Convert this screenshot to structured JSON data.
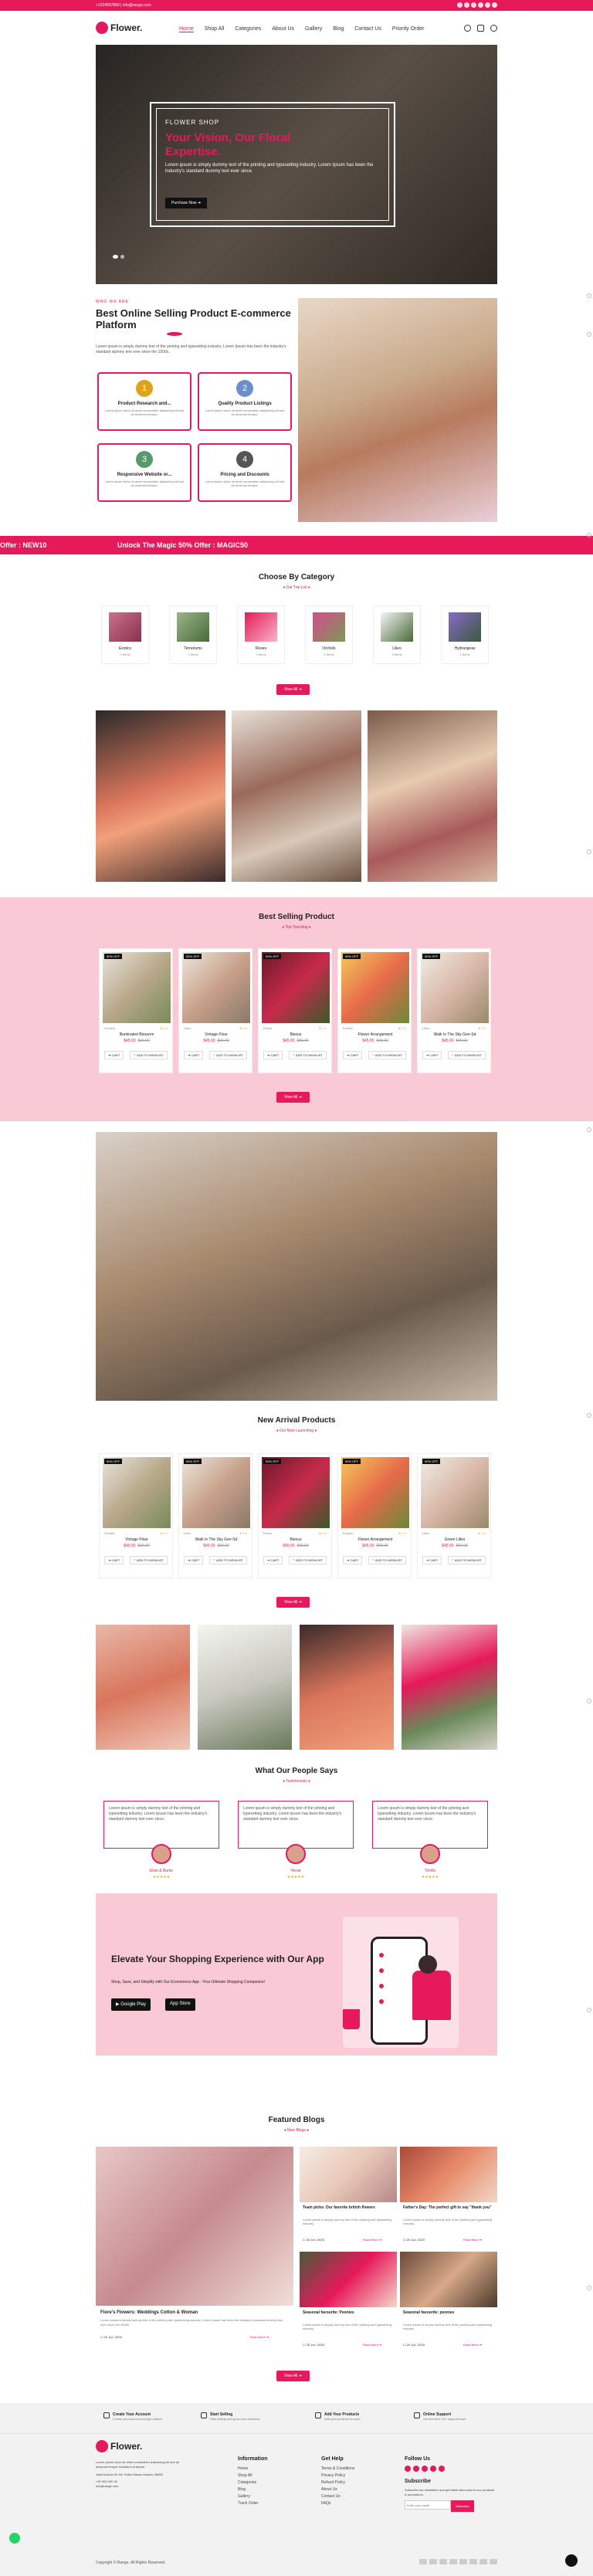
{
  "topbar": {
    "phone": "+1234567890",
    "email": "info@range.com",
    "socials": [
      "facebook-icon",
      "instagram-icon",
      "twitter-icon",
      "youtube-icon",
      "pinterest-icon",
      "linkedin-icon"
    ]
  },
  "header": {
    "logo": "Flower.",
    "nav": [
      "Home",
      "Shop All",
      "Categories",
      "About Us",
      "Gallery",
      "Blog",
      "Contact Us",
      "Priority Order"
    ],
    "active_nav": "Home"
  },
  "hero": {
    "kicker": "FLOWER SHOP",
    "title": "Your Vision, Our Floral Expertise.",
    "desc": "Lorem ipsum is simply dummy text of the printing and typesetting industry. Lorem Ipsum has been the industry's standard dummy text ever since.",
    "button": "Purchase Now  ➜"
  },
  "about": {
    "kicker": "WHO WE ARE",
    "title": "Best Online Selling Product E-commerce Platform",
    "desc": "Lorem ipsum is simply dummy text of the printing and typesetting industry. Lorem Ipsum has been the industry's standard dummy text ever since the 1500s.",
    "features": [
      {
        "num": "1",
        "title": "Product Research and...",
        "desc": "Lorem ipsum dolor sit amet consectetur adipiscing elit sed do eiusmod tempor.",
        "color": "#e0a21a"
      },
      {
        "num": "2",
        "title": "Quality Product Listings",
        "desc": "Lorem ipsum dolor sit amet consectetur adipiscing elit sed do eiusmod tempor.",
        "color": "#6a8fc9"
      },
      {
        "num": "3",
        "title": "Responsive Website or...",
        "desc": "Lorem ipsum dolor sit amet consectetur adipiscing elit sed do eiusmod tempor.",
        "color": "#5a9a6a"
      },
      {
        "num": "4",
        "title": "Pricing and Discounts",
        "desc": "Lorem ipsum dolor sit amet consectetur adipiscing elit sed do eiusmod tempor.",
        "color": "#555555"
      }
    ]
  },
  "marquee": {
    "left": "Offer : NEW10",
    "center": "Unlock The Magic 50% Offer : MAGIC50"
  },
  "categories": {
    "title": "Choose By Category",
    "subtitle": "♦ Our Top List ♦",
    "button": "View All  ➜",
    "items": [
      {
        "name": "Exotics",
        "count": "2 Items"
      },
      {
        "name": "Terrariums",
        "count": "3 Items"
      },
      {
        "name": "Roses",
        "count": "2 Items"
      },
      {
        "name": "Orchids",
        "count": "1 Items"
      },
      {
        "name": "Lilies",
        "count": "3 Items"
      },
      {
        "name": "Hydrangeas",
        "count": "1 Items"
      }
    ]
  },
  "best": {
    "title": "Best Selling Product",
    "subtitle": "♦ Top Trending ♦",
    "button": "View All  ➜",
    "products": [
      {
        "badge": "50% OFF",
        "cat": "Orchids",
        "name": "Illuminated Blossom",
        "price": "$45.00",
        "old": "$90.00",
        "rating": "★ 4.0"
      },
      {
        "badge": "50% OFF",
        "cat": "Lilies",
        "name": "Vintage Flour",
        "price": "$45.00",
        "old": "$90.00",
        "rating": "★ 4.0"
      },
      {
        "badge": "50% OFF",
        "cat": "Roses",
        "name": "Bisous",
        "price": "$45.00",
        "old": "$90.00",
        "rating": "★ 4.0"
      },
      {
        "badge": "50% OFF",
        "cat": "Exotics",
        "name": "Flower Arrangement",
        "price": "$45.00",
        "old": "$90.00",
        "rating": "★ 4.0"
      },
      {
        "badge": "50% OFF",
        "cat": "Lilies",
        "name": "Walk In The Sky Gen-Sd",
        "price": "$45.00",
        "old": "$90.00",
        "rating": "★ 4.0"
      }
    ],
    "cart": "➜ CART",
    "wish": "♡ ADD TO WISHLIST"
  },
  "arrivals": {
    "title": "New Arrival Products",
    "subtitle": "♦ Our New Launching ♦",
    "button": "View All  ➜",
    "products": [
      {
        "badge": "50% OFF",
        "cat": "Orchids",
        "name": "Vintage Flour",
        "price": "$45.00",
        "old": "$90.00",
        "rating": "★ 4.0"
      },
      {
        "badge": "50% OFF",
        "cat": "Lilies",
        "name": "Walk In The Sky Gen-Sd",
        "price": "$45.00",
        "old": "$90.00",
        "rating": "★ 4.0"
      },
      {
        "badge": "50% OFF",
        "cat": "Roses",
        "name": "Bisous",
        "price": "$45.00",
        "old": "$90.00",
        "rating": "★ 4.0"
      },
      {
        "badge": "50% OFF",
        "cat": "Exotics",
        "name": "Flower Arrangement",
        "price": "$45.00",
        "old": "$90.00",
        "rating": "★ 4.0"
      },
      {
        "badge": "50% OFF",
        "cat": "Lilies",
        "name": "Green Lilies",
        "price": "$45.00",
        "old": "$90.00",
        "rating": "★ 4.0"
      }
    ]
  },
  "testimonials": {
    "title": "What Our People Says",
    "subtitle": "♦ Testimonials ♦",
    "items": [
      {
        "text": "Lorem ipsum is simply dummy text of the printing and typesetting industry. Lorem Ipsum has been the industry's standard dummy text ever since.",
        "name": "Elsie & Burke",
        "stars": "★★★★★"
      },
      {
        "text": "Lorem ipsum is simply dummy text of the printing and typesetting industry. Lorem Ipsum has been the industry's standard dummy text ever since.",
        "name": "Henie",
        "stars": "★★★★★"
      },
      {
        "text": "Lorem ipsum is simply dummy text of the printing and typesetting industry. Lorem Ipsum has been the industry's standard dummy text ever since.",
        "name": "Timitto",
        "stars": "★★★★★"
      }
    ]
  },
  "app": {
    "title": "Elevate Your Shopping Experience with Our App",
    "desc": "Shop, Save, and Simplify with Our Ecommerce App - Your Ultimate Shopping Companion!",
    "google": "▶ Google Play",
    "apple": " App Store"
  },
  "blogs": {
    "title": "Featured Blogs",
    "subtitle": "♦ New Blogs ♦",
    "button": "View All  ➜",
    "main": {
      "title": "Fiore's Flowers: Weddings Cotton & Woman",
      "desc": "Lorem ipsum is simply dummy text of the printing and typesetting industry. Lorem Ipsum has been the industry's standard dummy text ever since the 1500s.",
      "date": "☐ 20 Jun, 2025",
      "more": "Read More ➜"
    },
    "items": [
      {
        "title": "Team picks: Our favorite british flowers",
        "desc": "Lorem ipsum is simply dummy text of the printing and typesetting industry.",
        "date": "☐ 20 Jun, 2025",
        "more": "Read More ➜"
      },
      {
        "title": "Father's Day: The perfect gift to say \"thank you\"",
        "desc": "Lorem ipsum is simply dummy text of the printing and typesetting industry.",
        "date": "☐ 20 Jun, 2025",
        "more": "Read More ➜"
      },
      {
        "title": "Seasonal favourite: Peonies",
        "desc": "Lorem ipsum is simply dummy text of the printing and typesetting industry.",
        "date": "☐ 20 Jun, 2025",
        "more": "Read More ➜"
      },
      {
        "title": "Seasonal favourite: peonies",
        "desc": "Lorem ipsum is simply dummy text of the printing and typesetting industry.",
        "date": "☐ 20 Jun, 2025",
        "more": "Read More ➜"
      }
    ]
  },
  "features_bar": [
    {
      "title": "Create Your Account",
      "sub": "Create your account and get started"
    },
    {
      "title": "Start Selling",
      "sub": "Start selling and grow your business"
    },
    {
      "title": "Add Your Products",
      "sub": "Add your products to store"
    },
    {
      "title": "Online Support",
      "sub": "We are here 24/7 support team"
    }
  ],
  "footer": {
    "logo": "Flower.",
    "about": "Lorem ipsum dolor sit amet consectetur adipiscing elit sed do eiusmod tempor incididunt ut labore.",
    "address": "Vasil Kolarov 80 No. Rzlen Mesec Ankara, 06800",
    "phone": "+90 000 000 00",
    "email": "info@range.com",
    "info_title": "Information",
    "info_links": [
      "Home",
      "Shop All",
      "Categories",
      "Blog",
      "Gallery",
      "Track Order"
    ],
    "help_title": "Get Help",
    "help_links": [
      "Terms & Conditions",
      "Privacy Policy",
      "Refund Policy",
      "About Us",
      "Contact Us",
      "FAQs"
    ],
    "follow_title": "Follow Us",
    "subscribe_title": "Subscribe",
    "subscribe_desc": "Subscribe our newsletter and get latest discounts for our products & promotions.",
    "email_placeholder": "Enter your email",
    "subscribe_btn": "Subscribe",
    "copyright": "Copyright © Range. All Rights Reserved."
  },
  "colors": {
    "accent": "#e6195a",
    "pink_bg": "#f9c9d6"
  }
}
